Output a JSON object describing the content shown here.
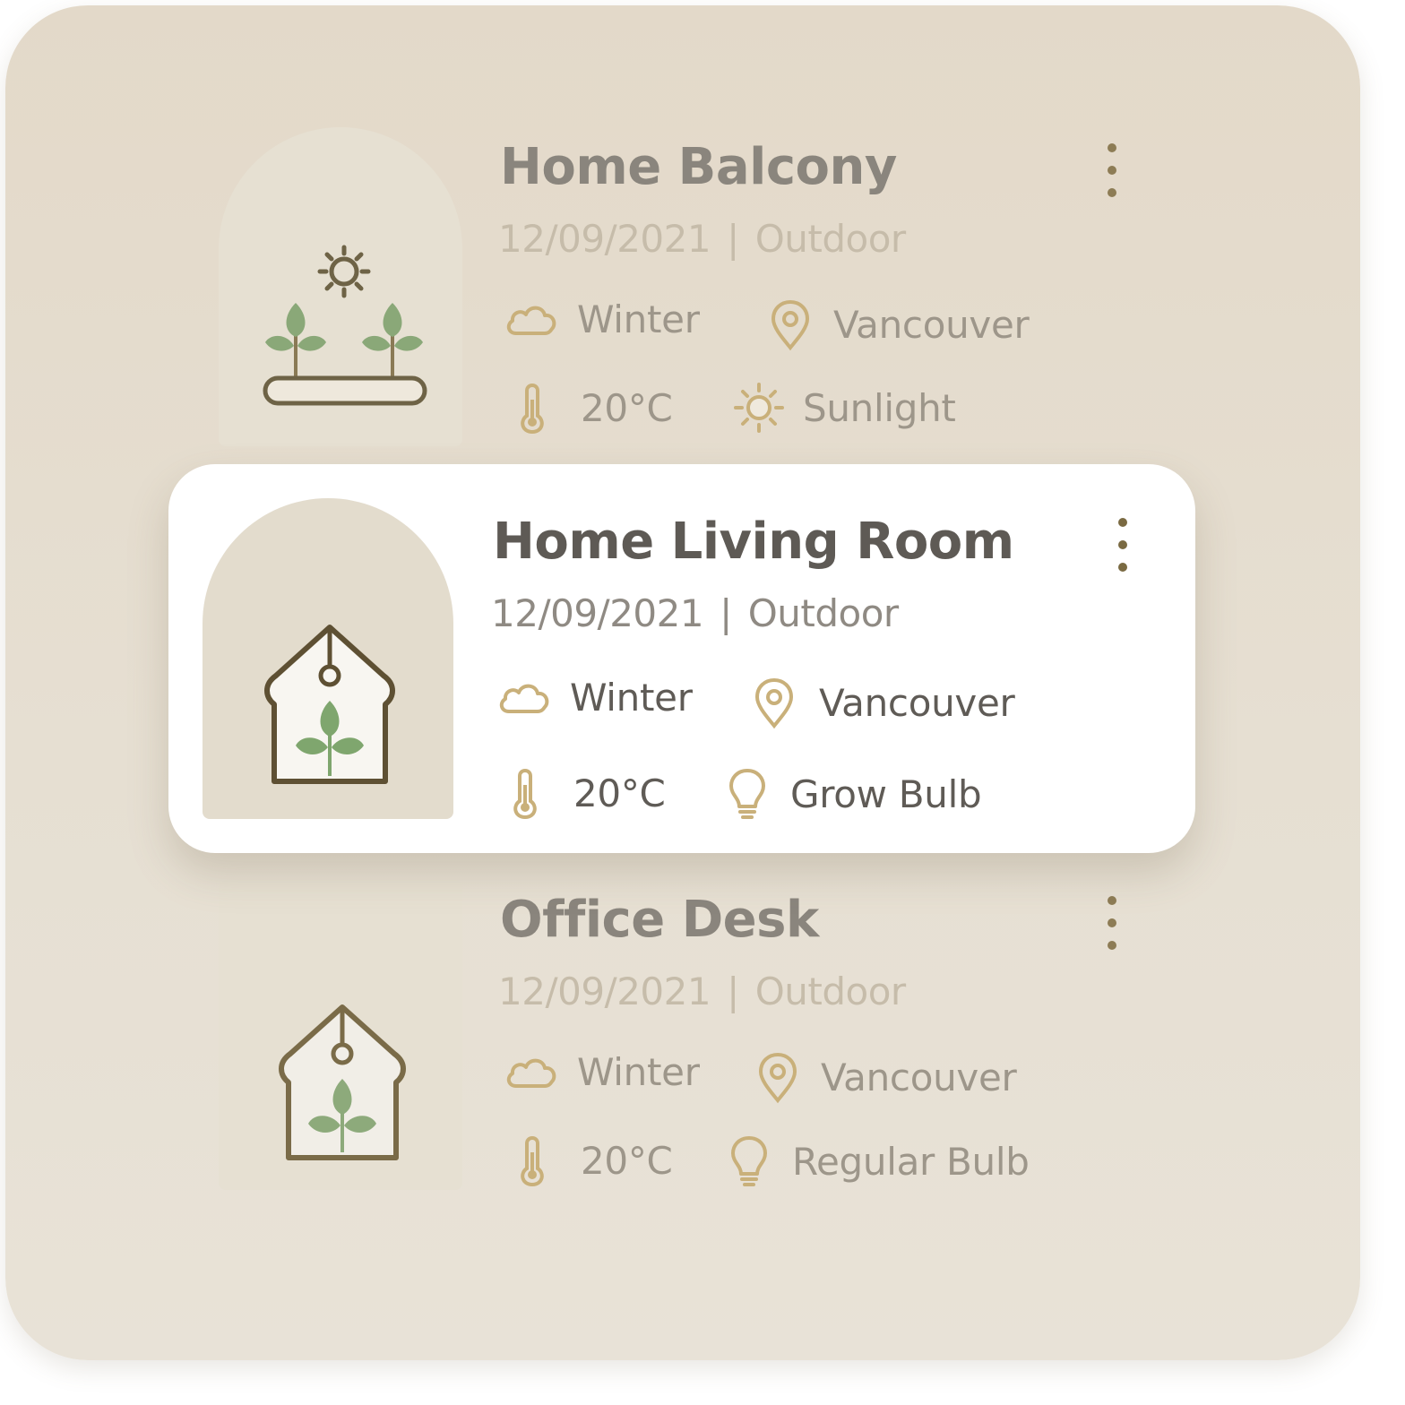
{
  "cards": [
    {
      "title": "Home Balcony",
      "date": "12/09/2021",
      "location_type": "Outdoor",
      "season": "Winter",
      "city": "Vancouver",
      "temperature": "20°C",
      "light": "Sunlight",
      "illustration": "planter-with-sun-icon",
      "light_icon": "sun-icon"
    },
    {
      "title": "Home Living Room",
      "date": "12/09/2021",
      "location_type": "Outdoor",
      "season": "Winter",
      "city": "Vancouver",
      "temperature": "20°C",
      "light": "Grow Bulb",
      "illustration": "greenhouse-plant-icon",
      "light_icon": "bulb-icon"
    },
    {
      "title": "Office Desk",
      "date": "12/09/2021",
      "location_type": "Outdoor",
      "season": "Winter",
      "city": "Vancouver",
      "temperature": "20°C",
      "light": "Regular Bulb",
      "illustration": "greenhouse-plant-icon",
      "light_icon": "bulb-icon"
    }
  ],
  "separator": "|",
  "colors": {
    "accent_gold": "#c9b07a",
    "leaf_green": "#7fa66e",
    "outline_brown": "#6b5a35",
    "panel_bg": "#e5ddcf",
    "card_bg": "#ffffff"
  }
}
